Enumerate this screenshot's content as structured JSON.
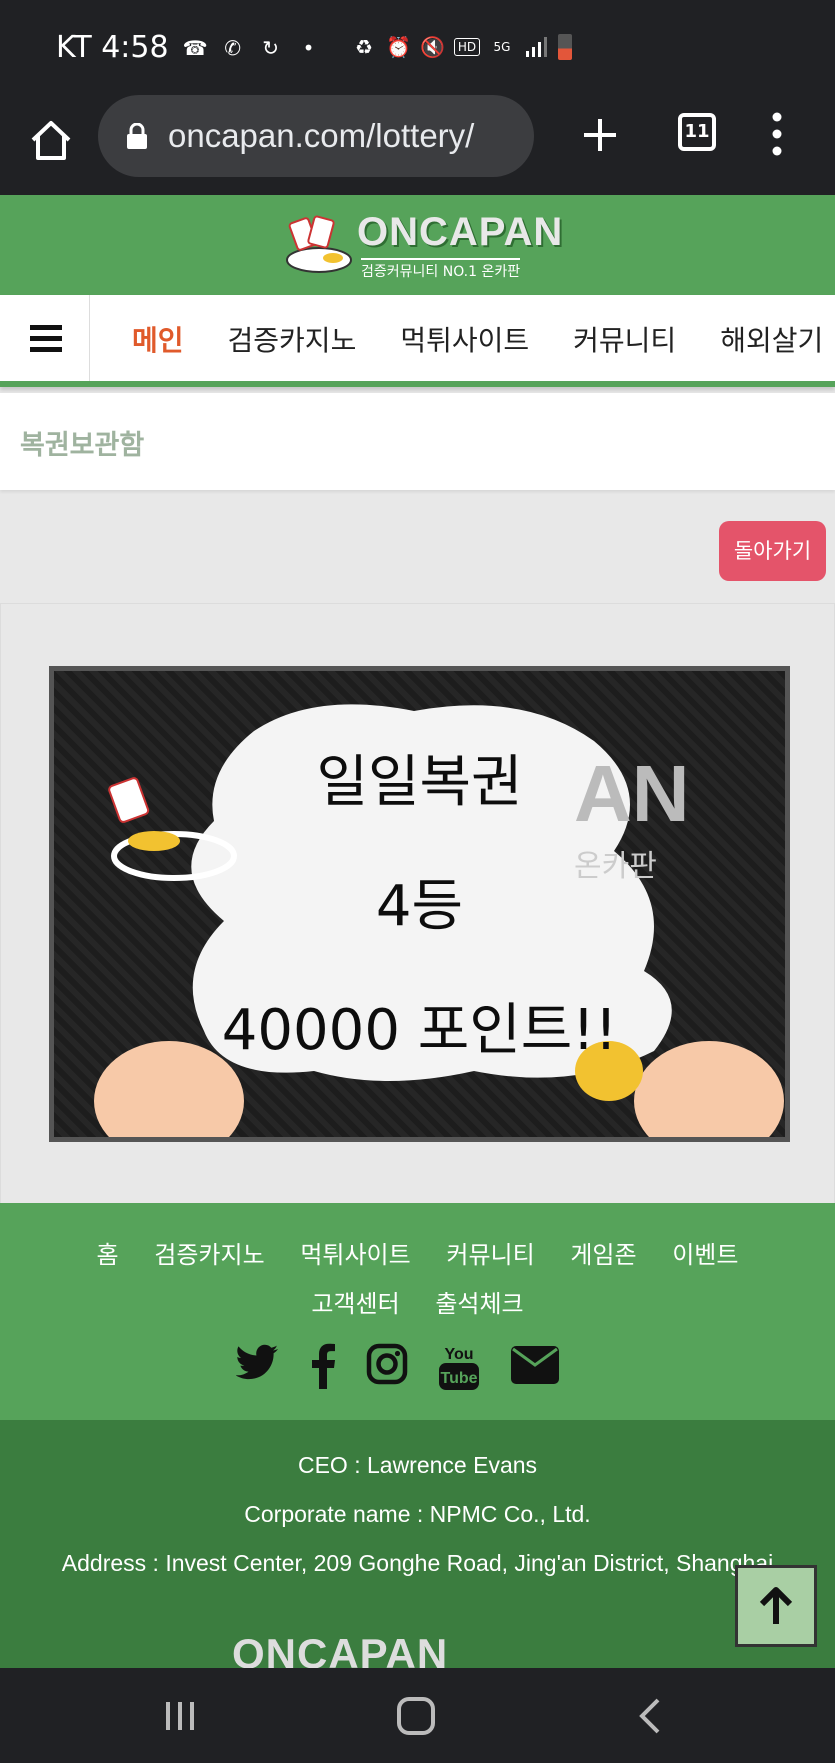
{
  "status_bar": {
    "carrier_time": "KT 4:58",
    "network": "5G"
  },
  "browser": {
    "url": "oncapan.com/lottery/",
    "tab_count": "11"
  },
  "site": {
    "logo_text": "ONCAPAN",
    "logo_sub": "검증커뮤니티 NO.1 온카판",
    "brand_color": "#56a35a"
  },
  "nav": {
    "items": [
      "메인",
      "검증카지노",
      "먹튀사이트",
      "커뮤니티",
      "해외살기"
    ]
  },
  "page": {
    "title": "복권보관함",
    "back_label": "돌아가기"
  },
  "prize": {
    "line1": "일일복권",
    "line2": "4등",
    "line3": "40000 포인트!!"
  },
  "footer": {
    "links": [
      "홈",
      "검증카지노",
      "먹튀사이트",
      "커뮤니티",
      "게임존",
      "이벤트",
      "고객센터",
      "출석체크"
    ],
    "social_icons": [
      "twitter-icon",
      "facebook-icon",
      "instagram-icon",
      "youtube-icon",
      "mail-icon"
    ],
    "ceo": "CEO : Lawrence Evans",
    "corporate": "Corporate name : NPMC Co., Ltd.",
    "address": "Address : Invest Center, 209 Gonghe Road, Jing'an District, Shanghai",
    "logo_text": "ONCAPAN"
  }
}
